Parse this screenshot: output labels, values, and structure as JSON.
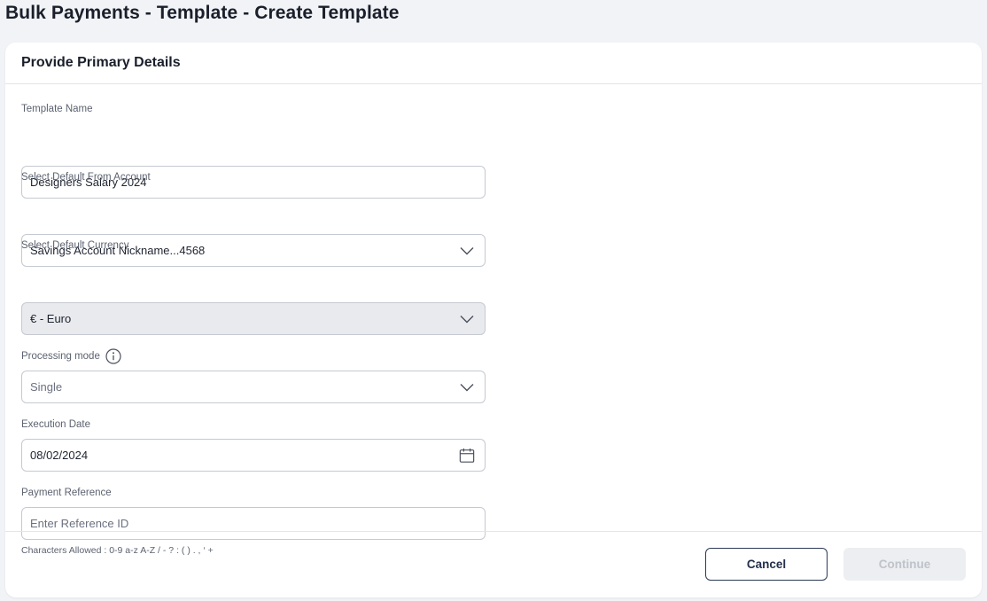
{
  "page": {
    "title": "Bulk Payments - Template - Create Template"
  },
  "card": {
    "title": "Provide Primary Details"
  },
  "form": {
    "template_name": {
      "label": "Template Name",
      "value": "Designers Salary 2024"
    },
    "from_account": {
      "label": "Select Default From Account",
      "value": "Savings Account Nickname...4568",
      "icon": "chevron-down-icon"
    },
    "currency": {
      "label": "Select Default Currency",
      "value": "€ - Euro",
      "disabled": true,
      "icon": "chevron-down-icon"
    },
    "processing_mode": {
      "label": "Processing mode",
      "value": "Single",
      "info_icon": "info-icon",
      "icon": "chevron-down-icon"
    },
    "execution_date": {
      "label": "Execution Date",
      "value": "08/02/2024",
      "icon": "calendar-icon"
    },
    "payment_reference": {
      "label": "Payment Reference",
      "placeholder": "Enter Reference ID",
      "value": "",
      "hint": "Characters Allowed : 0-9 a-z A-Z / - ? : ( ) . , ‘ +"
    }
  },
  "footer": {
    "cancel_label": "Cancel",
    "continue_label": "Continue",
    "continue_disabled": true
  },
  "colors": {
    "page_background": "#f1f3f6",
    "card_background": "#ffffff",
    "border": "#c5c9d1",
    "disabled_field": "#e9eaee",
    "primary_outline": "#2b3a55",
    "disabled_button": "#eceef1"
  }
}
